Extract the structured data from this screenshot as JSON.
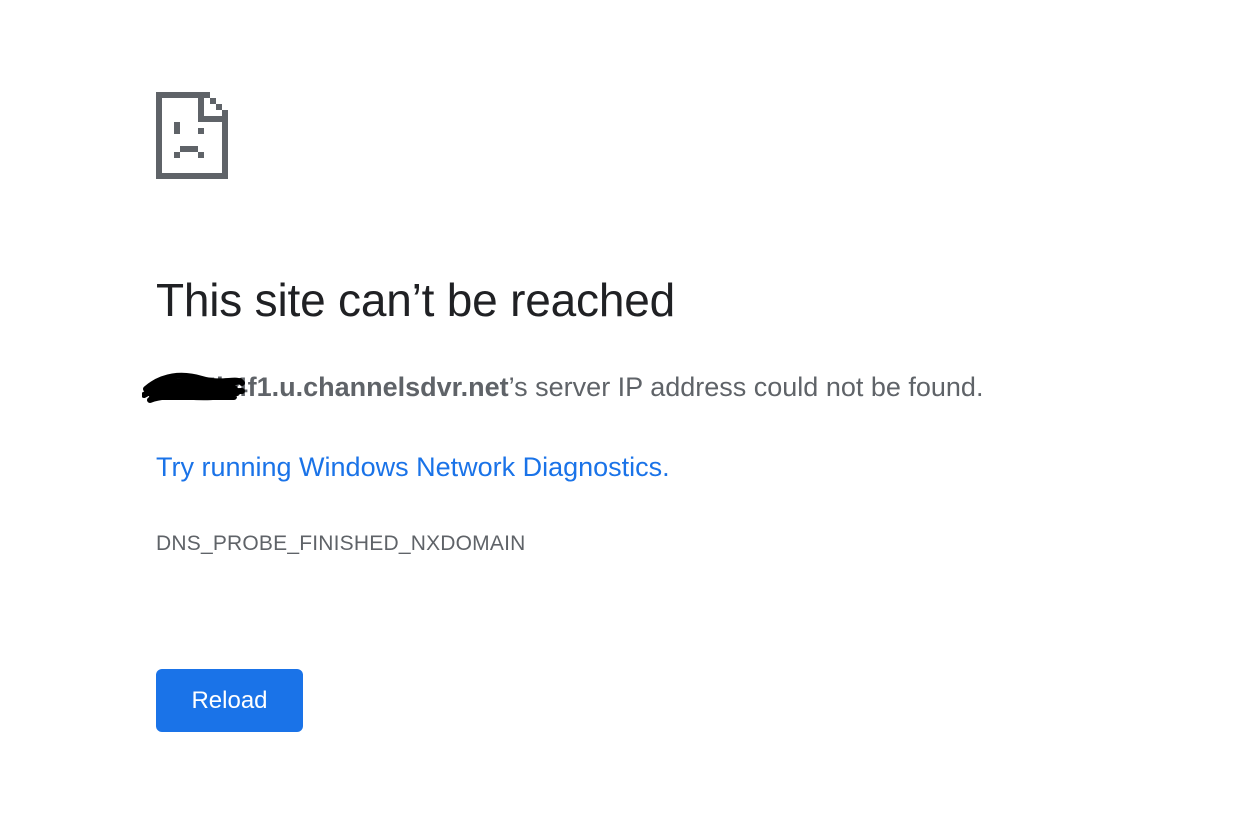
{
  "icon": {
    "name": "sad-page-icon",
    "color": "#5f6368"
  },
  "error": {
    "title": "This site can’t be reached",
    "host": "8875b4f1.u.channelsdvr.net",
    "summary_suffix": "’s server IP address could not be found.",
    "diagnostics_link": "Try running Windows Network Diagnostics",
    "diagnostics_period": ".",
    "code": "DNS_PROBE_FINISHED_NXDOMAIN"
  },
  "actions": {
    "reload_label": "Reload"
  },
  "colors": {
    "title": "#202124",
    "body_text": "#5f6368",
    "link": "#1a73e8",
    "button_bg": "#1a73e8",
    "button_text": "#ffffff"
  }
}
